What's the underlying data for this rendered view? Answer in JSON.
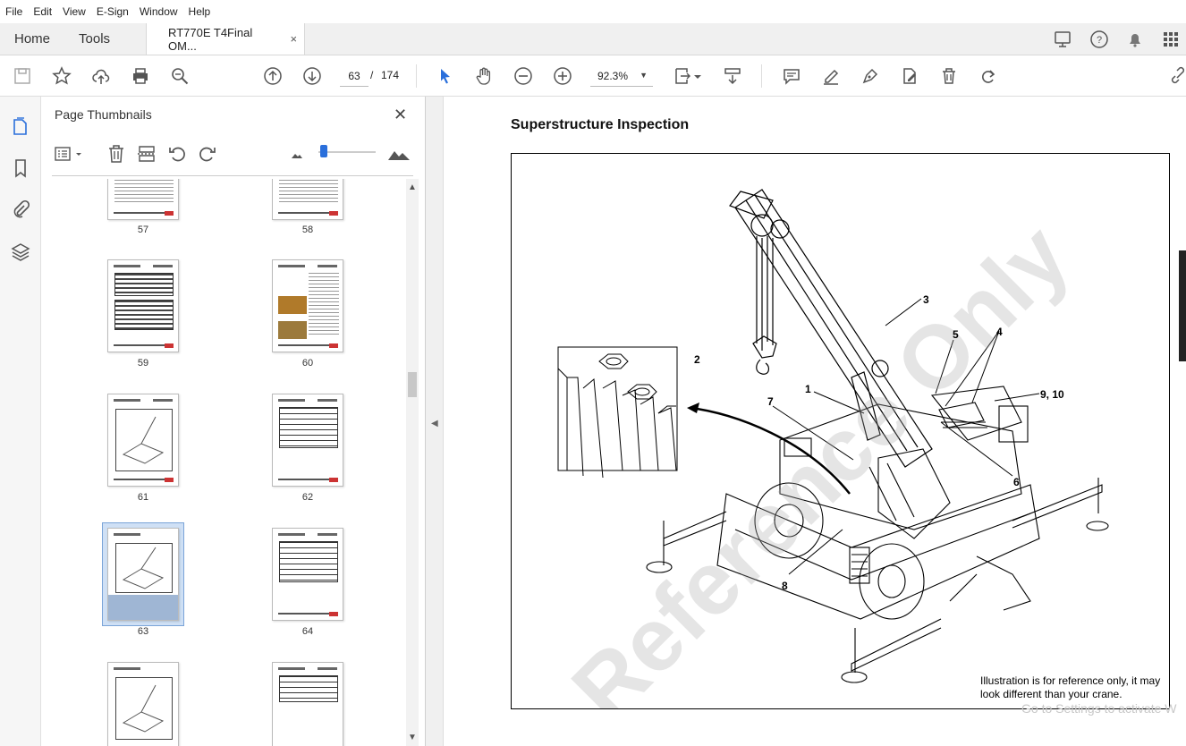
{
  "menu": [
    "File",
    "Edit",
    "View",
    "E-Sign",
    "Window",
    "Help"
  ],
  "tabs": {
    "home": "Home",
    "tools": "Tools",
    "document": "RT770E T4Final OM...",
    "close": "×"
  },
  "toolbar": {
    "current_page": "63",
    "page_separator": "/",
    "total_pages": "174",
    "zoom": "92.3%"
  },
  "panel": {
    "title": "Page Thumbnails",
    "close": "✕"
  },
  "thumbnails": {
    "p57": "57",
    "p58": "58",
    "p59": "59",
    "p60": "60",
    "p61": "61",
    "p62": "62",
    "p63": "63",
    "p64": "64",
    "selected": "63"
  },
  "document": {
    "title": "Superstructure Inspection",
    "caption": "Illustration is for reference only, it may look different than your crane.",
    "watermark": "Reference Only",
    "callouts": [
      "1",
      "2",
      "3",
      "4",
      "5",
      "6",
      "7",
      "8",
      "9, 10"
    ]
  },
  "overlay": {
    "activate_windows": "Go to Settings to activate W"
  },
  "colors": {
    "accent": "#2a6fdb",
    "selection": "#cfe0f5"
  }
}
